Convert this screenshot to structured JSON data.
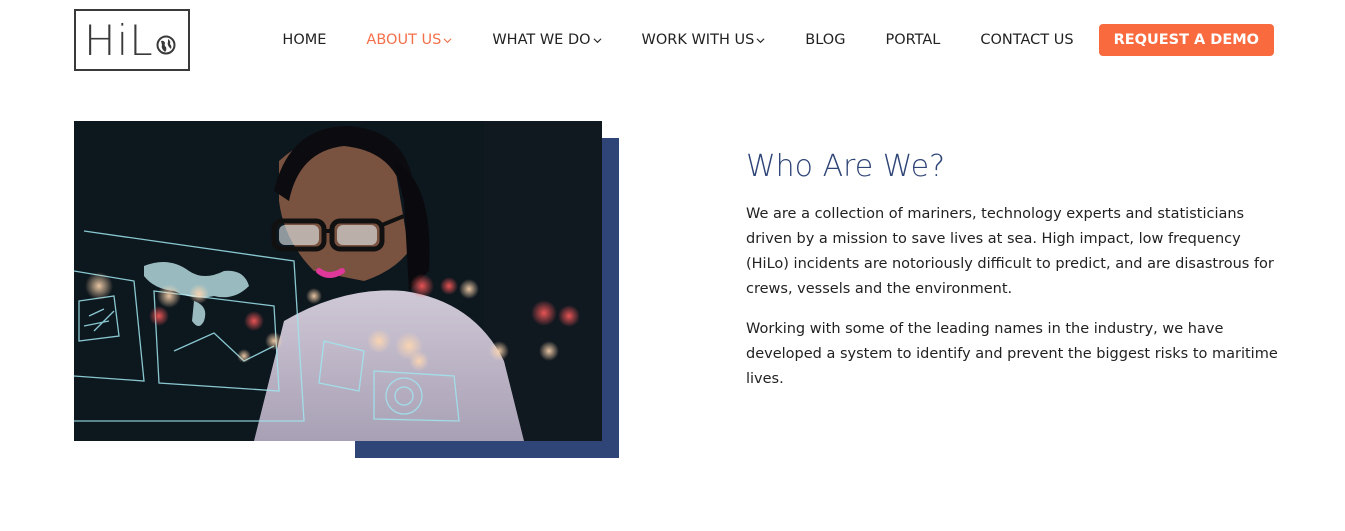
{
  "logo": {
    "text": "HiL",
    "trailing_icon": "globe-icon"
  },
  "nav": {
    "items": [
      {
        "label": "HOME",
        "dropdown": false,
        "active": false
      },
      {
        "label": "ABOUT US",
        "dropdown": true,
        "active": true
      },
      {
        "label": "WHAT WE DO",
        "dropdown": true,
        "active": false
      },
      {
        "label": "WORK WITH US",
        "dropdown": true,
        "active": false
      },
      {
        "label": "BLOG",
        "dropdown": false,
        "active": false
      },
      {
        "label": "PORTAL",
        "dropdown": false,
        "active": false
      },
      {
        "label": "CONTACT US",
        "dropdown": false,
        "active": false
      }
    ],
    "cta_label": "REQUEST A DEMO"
  },
  "about": {
    "title": "Who Are We?",
    "paragraphs": [
      "We are a collection of mariners, technology experts and statisticians driven by a mission to save lives at sea. High impact, low frequency (HiLo) incidents are notoriously difficult to predict, and are disastrous for crews, vessels and the environment.",
      "Working with some of the leading names in the industry, we have developed a system to identify and prevent the biggest risks to maritime lives."
    ]
  },
  "colors": {
    "accent_orange": "#f96b3f",
    "navy": "#2f4577",
    "text": "#222222"
  }
}
